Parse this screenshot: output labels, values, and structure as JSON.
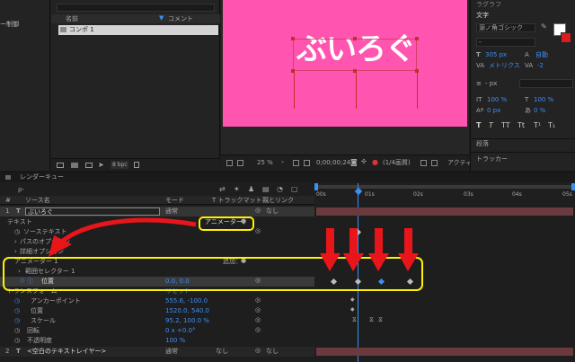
{
  "colors": {
    "canvas": "#ff55b0",
    "annotation_red": "#e8151b",
    "annotation_yellow": "#fff200",
    "playhead": "#3d8df5"
  },
  "left_panel": {
    "item": "ー制御"
  },
  "project": {
    "col_name": "名前",
    "col_comment": "コメント",
    "comp_name": "コンポ 1",
    "bpc": "8 bpc"
  },
  "viewer": {
    "canvas_text": "ぶいろぐ",
    "zoom": "25 %",
    "timecode": "0;00;00;24",
    "quality": "(1/4画質)",
    "active": "アクティ"
  },
  "character": {
    "tab": "ラグラフ",
    "title": "文字",
    "font": "源ノ角ゴシック",
    "font_style": "-",
    "font_size": "305 px",
    "leading": "自動",
    "tracking_metric": "メトリクス",
    "tracking": "-2",
    "stroke": "- px",
    "vscale": "100 %",
    "hscale": "100 %",
    "baseline": "0 px",
    "tsume": "0 %",
    "style_buttons": [
      "T",
      "T",
      "TT",
      "Tt",
      "T¹",
      "T₁"
    ],
    "paragraph": "段落",
    "tracker": "トラッカー"
  },
  "timeline": {
    "tab": "レンダーキュー",
    "search": "ρ-",
    "headers": {
      "source": "ソース名",
      "mode": "モード",
      "track": "T トラックマット",
      "parent": "親とリンク"
    },
    "ruler": [
      "00s",
      "01s",
      "02s",
      "03s",
      "04s",
      "05s"
    ],
    "layer1": {
      "num": "1",
      "type": "T",
      "name": "ぶいろぐ",
      "mode": "通常",
      "parent": "なし"
    },
    "animator_label": "アニメーター：",
    "rows": {
      "text": "テキスト",
      "source_text": "ソーステキスト",
      "path_options": "パスのオプション",
      "more_options": "詳細オプション",
      "animator1": "アニメーター 1",
      "add": "追加：",
      "range_selector": "範囲セレクター 1",
      "position": "位置",
      "position_value": "0.0, 0.0",
      "transform": "トランスフォーム",
      "reset": "リセット",
      "anchor": "アンカーポイント",
      "anchor_value": "555.6, -100.0",
      "pos": "位置",
      "pos_value": "1520.0, 540.0",
      "scale": "スケール",
      "scale_value": "95.2, 100.0 %",
      "rotation": "回転",
      "rotation_value": "0 x +0.0°",
      "opacity": "不透明度",
      "opacity_value": "100 %"
    },
    "layer2": {
      "num": "2",
      "type": "T",
      "name": "<空白のテキストレイヤー>",
      "mode": "通常",
      "track": "なし",
      "parent": "なし"
    }
  }
}
